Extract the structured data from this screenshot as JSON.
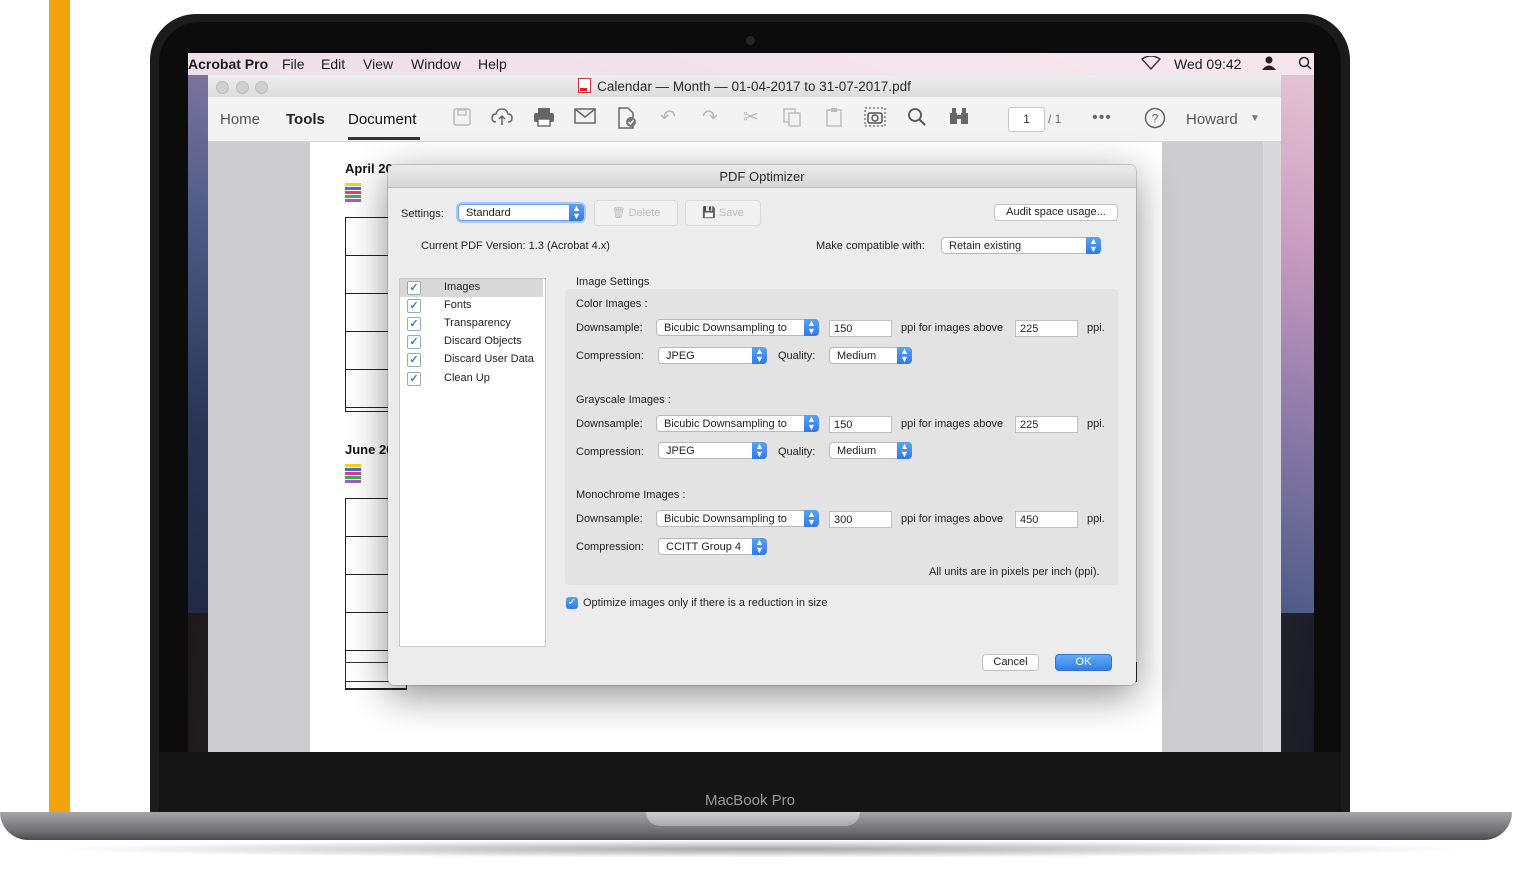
{
  "menubar": {
    "app": "Acrobat Pro",
    "items": [
      "File",
      "Edit",
      "View",
      "Window",
      "Help"
    ],
    "clock": "Wed 09:42"
  },
  "window": {
    "title": "Calendar — Month — 01-04-2017 to 31-07-2017.pdf"
  },
  "toolbar": {
    "tabs": [
      "Home",
      "Tools",
      "Document"
    ],
    "page_current": "1",
    "page_total": "/ 1",
    "user": "Howard"
  },
  "document": {
    "heading1": "April 20",
    "heading2": "June 20",
    "legend_colors": [
      "#f3d21c",
      "#4a6bd8",
      "#e03a8a",
      "#3ab04a",
      "#9a5fd0",
      "#f08a2a"
    ]
  },
  "dialog": {
    "title": "PDF Optimizer",
    "settings_label": "Settings:",
    "settings_value": "Standard",
    "delete_label": "Delete",
    "save_label": "Save",
    "audit_label": "Audit space usage...",
    "version_text": "Current PDF Version: 1.3 (Acrobat 4.x)",
    "compat_label": "Make compatible with:",
    "compat_value": "Retain existing",
    "categories": [
      "Images",
      "Fonts",
      "Transparency",
      "Discard Objects",
      "Discard User Data",
      "Clean Up"
    ],
    "panel_title": "Image Settings",
    "downsample_label": "Downsample:",
    "compression_label": "Compression:",
    "quality_label": "Quality:",
    "ppi_above_label": "ppi for images above",
    "ppi_label": "ppi.",
    "color": {
      "title": "Color Images :",
      "method": "Bicubic Downsampling to",
      "ppi": "150",
      "above": "225",
      "compression": "JPEG",
      "quality": "Medium"
    },
    "gray": {
      "title": "Grayscale Images :",
      "method": "Bicubic Downsampling to",
      "ppi": "150",
      "above": "225",
      "compression": "JPEG",
      "quality": "Medium"
    },
    "mono": {
      "title": "Monochrome Images :",
      "method": "Bicubic Downsampling to",
      "ppi": "300",
      "above": "450",
      "compression": "CCITT Group 4"
    },
    "units_note": "All units are in pixels per inch (ppi).",
    "optimize_only": "Optimize images only if there is a reduction in size",
    "cancel": "Cancel",
    "ok": "OK"
  },
  "laptop": {
    "brand": "MacBook Pro"
  },
  "colors": {
    "accent": "#F3A20C",
    "primary_button": "#2f7fe9"
  }
}
